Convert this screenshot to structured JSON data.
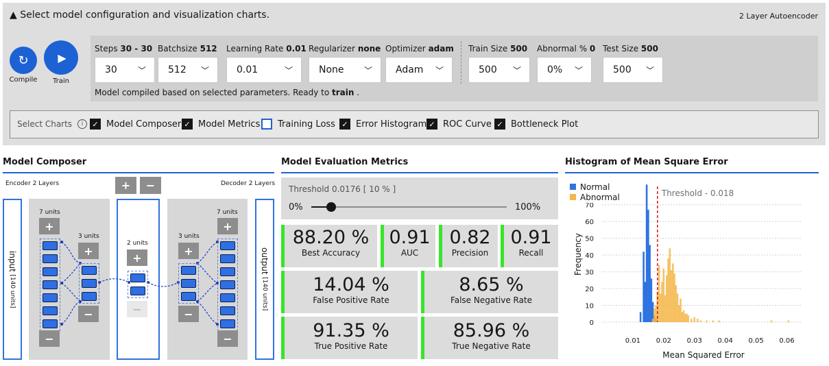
{
  "header": {
    "title": "▲ Select model configuration and visualization charts.",
    "app_name": "2 Layer Autoencoder"
  },
  "buttons": {
    "compile": "Compile",
    "train": "Train"
  },
  "params": [
    {
      "label": "Steps",
      "value": "30 - 30",
      "selected": "30"
    },
    {
      "label": "Batchsize",
      "value": "512",
      "selected": "512"
    },
    {
      "label": "Learning Rate",
      "value": "0.01",
      "selected": "0.01"
    },
    {
      "label": "Regularizer",
      "value": "none",
      "selected": "None"
    },
    {
      "label": "Optimizer",
      "value": "adam",
      "selected": "Adam"
    },
    {
      "label": "Train Size",
      "value": "500",
      "selected": "500"
    },
    {
      "label": "Abnormal %",
      "value": "0",
      "selected": "0%"
    },
    {
      "label": "Test Size",
      "value": "500",
      "selected": "500"
    }
  ],
  "status": {
    "prefix": "Model compiled based on selected parameters. Ready to",
    "action": "train",
    "suffix": "."
  },
  "charts": {
    "label": "Select Charts",
    "items": [
      {
        "label": "Model Composer",
        "checked": true
      },
      {
        "label": "Model Metrics",
        "checked": true
      },
      {
        "label": "Training Loss",
        "checked": false
      },
      {
        "label": "Error Histogram",
        "checked": true
      },
      {
        "label": "ROC Curve",
        "checked": true
      },
      {
        "label": "Bottleneck Plot",
        "checked": true
      }
    ]
  },
  "composer": {
    "title": "Model Composer",
    "encoder_label": "Encoder 2 Layers",
    "decoder_label": "Decoder 2 Layers",
    "input_label": "input",
    "input_units": "[140 units]",
    "output_label": "output",
    "output_units": "[140 units]",
    "layers": {
      "enc1": "7 units",
      "enc2": "3 units",
      "bottleneck": "2 units",
      "dec1": "3 units",
      "dec2": "7 units"
    },
    "plus": "+",
    "minus": "−"
  },
  "metrics": {
    "title": "Model Evaluation Metrics",
    "threshold_label": "Threshold 0.0176 [ 10 % ]",
    "slider_min": "0%",
    "slider_max": "100%",
    "slider_value": 0.1,
    "cards": [
      {
        "value": "88.20 %",
        "label": "Best Accuracy"
      },
      {
        "value": "0.91",
        "label": "AUC"
      },
      {
        "value": "0.82",
        "label": "Precision"
      },
      {
        "value": "0.91",
        "label": "Recall"
      },
      {
        "value": "14.04 %",
        "label": "False Positive Rate"
      },
      {
        "value": "8.65 %",
        "label": "False Negative Rate"
      },
      {
        "value": "91.35 %",
        "label": "True Positive Rate"
      },
      {
        "value": "85.96 %",
        "label": "True Negative Rate"
      }
    ]
  },
  "chart_data": {
    "type": "bar",
    "title": "Histogram of Mean Square Error",
    "xlabel": "Mean Squared Error",
    "ylabel": "Frequency",
    "xlim": [
      0.0,
      0.065
    ],
    "ylim": [
      0,
      85
    ],
    "xticks": [
      0.01,
      0.02,
      0.03,
      0.04,
      0.05,
      0.06
    ],
    "yticks": [
      0,
      10,
      20,
      30,
      40,
      50,
      60,
      70
    ],
    "threshold": 0.018,
    "threshold_label": "Threshold - 0.018",
    "legend_position": "top-left",
    "series": [
      {
        "name": "Normal",
        "color": "#2f73e0",
        "x": [
          0.0125,
          0.0135,
          0.014,
          0.0145,
          0.015,
          0.0155,
          0.016,
          0.0165,
          0.017,
          0.0175,
          0.018
        ],
        "values": [
          6,
          42,
          24,
          82,
          67,
          46,
          26,
          12,
          4,
          2,
          1
        ]
      },
      {
        "name": "Abnormal",
        "color": "#f5b74a",
        "x": [
          0.0165,
          0.017,
          0.0175,
          0.018,
          0.0185,
          0.019,
          0.0195,
          0.02,
          0.0205,
          0.021,
          0.0215,
          0.022,
          0.0225,
          0.023,
          0.0235,
          0.024,
          0.0245,
          0.025,
          0.0255,
          0.026,
          0.0265,
          0.027,
          0.0275,
          0.028,
          0.029,
          0.03,
          0.031,
          0.032,
          0.034,
          0.036,
          0.038,
          0.055,
          0.0605
        ],
        "values": [
          2,
          8,
          10,
          18,
          34,
          17,
          24,
          32,
          16,
          28,
          38,
          44,
          31,
          35,
          29,
          22,
          17,
          10,
          14,
          6,
          7,
          5,
          5,
          4,
          2,
          3,
          2,
          1,
          1,
          1,
          1,
          1,
          1
        ]
      }
    ]
  }
}
